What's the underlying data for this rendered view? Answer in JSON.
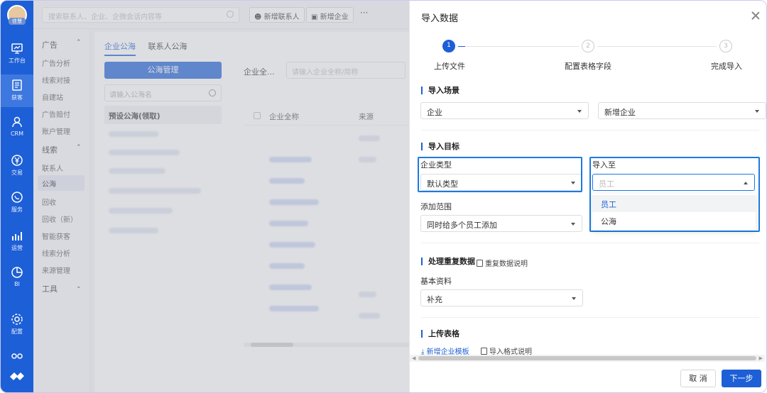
{
  "rail": {
    "user_name": "佳慧",
    "items": [
      {
        "icon": "workbench-icon",
        "label": "工作台"
      },
      {
        "icon": "acquire-icon",
        "label": "获客"
      },
      {
        "icon": "person-icon",
        "label": "CRM"
      },
      {
        "icon": "yen-icon",
        "label": "交易"
      },
      {
        "icon": "chat-icon",
        "label": "服务"
      },
      {
        "icon": "bar-chart-icon",
        "label": "运营"
      },
      {
        "icon": "pie-chart-icon",
        "label": "BI"
      },
      {
        "icon": "gear-icon",
        "label": "配置"
      }
    ]
  },
  "topbar": {
    "search_placeholder": "搜索联系人、企业、企微会话内容等",
    "new_contact": "新增联系人",
    "new_company": "新增企业",
    "more": "···"
  },
  "subnav": {
    "group_ad": "广告",
    "ad_items": [
      "广告分析",
      "线索对接",
      "自建站",
      "广告赔付",
      "账户管理"
    ],
    "group_leads": "线索",
    "lead_items": [
      "联系人",
      "公海",
      "回收",
      "回收（新）",
      "智能获客",
      "线索分析",
      "来源管理"
    ],
    "group_tools": "工具"
  },
  "content": {
    "tabs": [
      "企业公海",
      "联系人公海"
    ],
    "pool_manage": "公海管理",
    "pool_search_placeholder": "请输入公海名",
    "preset_pool": "预设公海(领取)",
    "company_all": "企业全...",
    "company_search_placeholder": "请输入企业全称/简称",
    "col_name": "企业全称",
    "col_source": "来源"
  },
  "drawer": {
    "title": "导入数据",
    "steps": [
      {
        "num": "1",
        "label": "上传文件"
      },
      {
        "num": "2",
        "label": "配置表格字段"
      },
      {
        "num": "3",
        "label": "完成导入"
      }
    ],
    "scene_title": "导入场景",
    "scene_object": "企业",
    "scene_action": "新增企业",
    "target_title": "导入目标",
    "company_type_label": "企业类型",
    "company_type_value": "默认类型",
    "import_to_label": "导入至",
    "import_to_placeholder": "员工",
    "import_to_options": [
      "员工",
      "公海"
    ],
    "add_scope_label": "添加范围",
    "add_scope_value": "同时给多个员工添加",
    "dup_title": "处理重复数据",
    "dup_help": "重复数据说明",
    "basic_label": "基本资料",
    "basic_value": "补充",
    "upload_title": "上传表格",
    "template_link": "新增企业模板",
    "format_help": "导入格式说明",
    "cancel": "取 消",
    "next": "下一步"
  }
}
